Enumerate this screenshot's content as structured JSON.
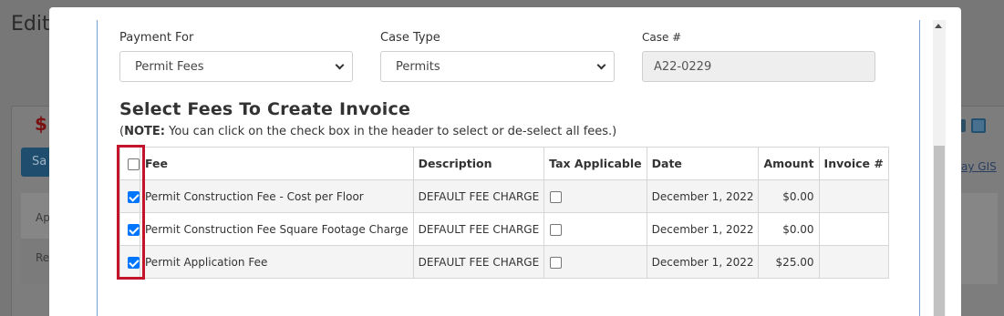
{
  "background": {
    "title": "Edit",
    "dollar": "$",
    "button": "Sa",
    "row1": "Ap",
    "row2": "Re",
    "link": "ay GIS"
  },
  "form": {
    "payment_for_label": "Payment For",
    "payment_for_value": "Permit Fees",
    "case_type_label": "Case Type",
    "case_type_value": "Permits",
    "case_no_label": "Case #",
    "case_no_value": "A22-0229"
  },
  "section": {
    "heading": "Select Fees To Create Invoice",
    "note_open": "(",
    "note_bold": "NOTE:",
    "note_text": " You can click on the check box in the header to select or de-select all fees.)"
  },
  "table": {
    "headers": {
      "fee": "Fee",
      "description": "Description",
      "tax": "Tax Applicable",
      "date": "Date",
      "amount": "Amount",
      "invoice": "Invoice #"
    },
    "header_checked": false,
    "rows": [
      {
        "checked": true,
        "fee": "Permit Construction Fee - Cost per Floor",
        "description": "DEFAULT FEE CHARGE",
        "tax": false,
        "date": "December 1, 2022",
        "amount": "$0.00",
        "invoice": ""
      },
      {
        "checked": true,
        "fee": "Permit Construction Fee Square Footage Charge",
        "description": "DEFAULT FEE CHARGE",
        "tax": false,
        "date": "December 1, 2022",
        "amount": "$0.00",
        "invoice": ""
      },
      {
        "checked": true,
        "fee": "Permit Application Fee",
        "description": "DEFAULT FEE CHARGE",
        "tax": false,
        "date": "December 1, 2022",
        "amount": "$25.00",
        "invoice": ""
      }
    ]
  },
  "colors": {
    "checkbox_checked": "#0075ff",
    "highlight": "#c4142c",
    "panel_border": "#7aa0d4"
  },
  "icons": {
    "select_chevron": "chevron-down-icon",
    "scroll_up": "scroll-up-arrow-icon"
  }
}
